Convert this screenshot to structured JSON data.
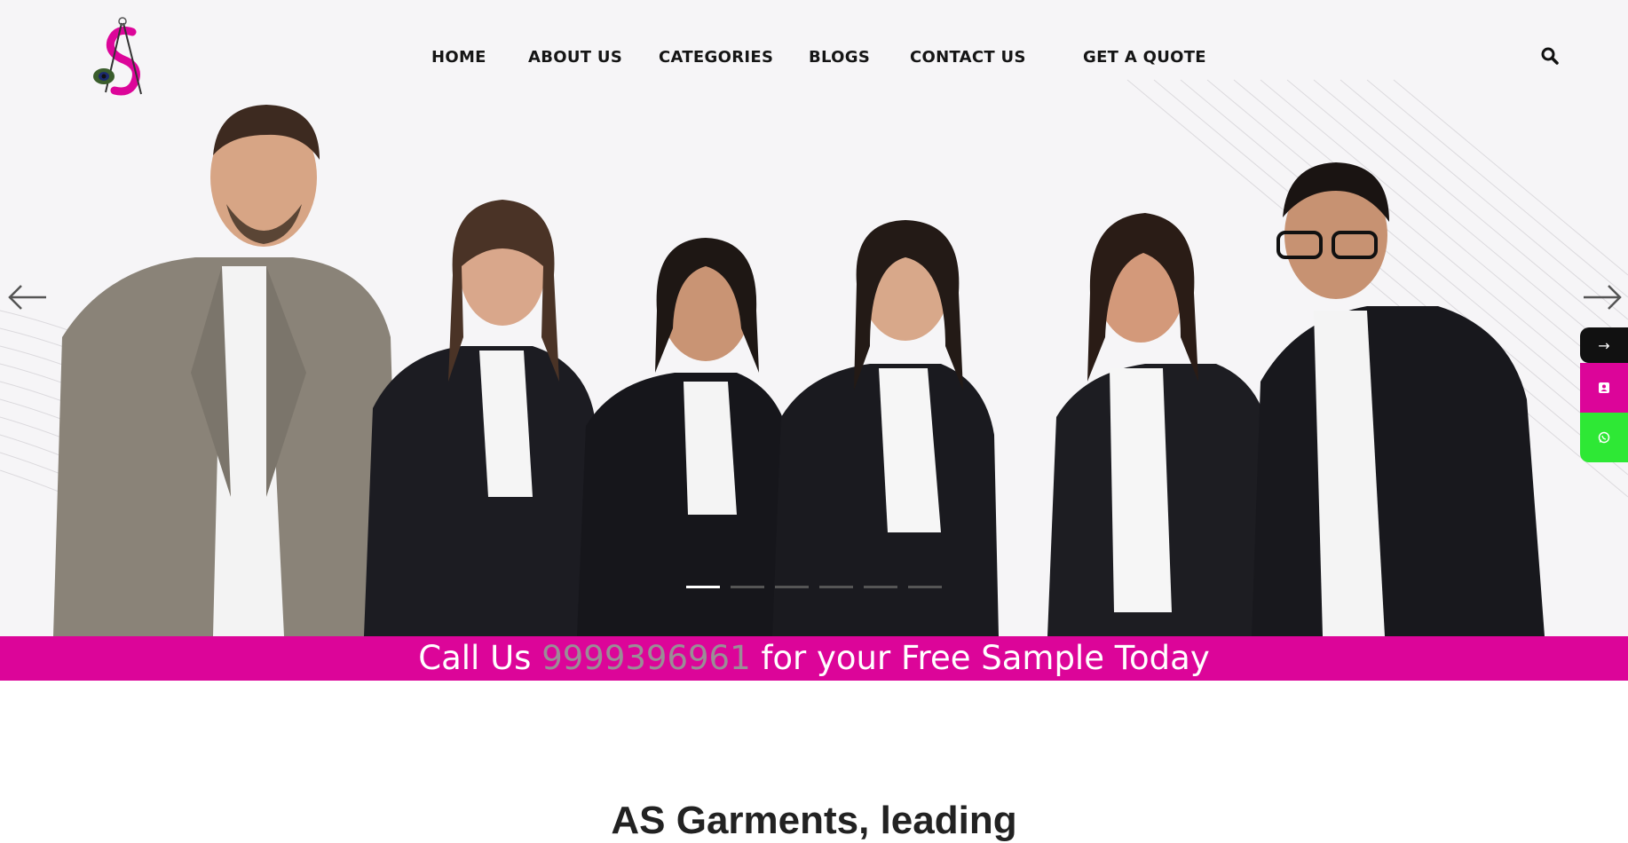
{
  "nav": {
    "items": [
      {
        "label": "HOME"
      },
      {
        "label": "ABOUT US"
      },
      {
        "label": "CATEGORIES"
      },
      {
        "label": "BLOGS"
      },
      {
        "label": "CONTACT US"
      },
      {
        "label": "GET A QUOTE"
      }
    ]
  },
  "header": {
    "logo_letter": "S",
    "search_icon": "search-icon"
  },
  "slider": {
    "prev_icon": "arrow-left-icon",
    "next_icon": "arrow-right-icon",
    "slide_count": 6,
    "active_slide": 1
  },
  "side_tabs": [
    {
      "icon": "arrow-right-icon",
      "glyph": "→",
      "color": "#111111"
    },
    {
      "icon": "contact-card-icon",
      "glyph": "▪",
      "color": "#dc0599"
    },
    {
      "icon": "whatsapp-icon",
      "glyph": "◯",
      "color": "#2ee835"
    }
  ],
  "banner": {
    "prefix": "Call Us ",
    "phone": "9999396961",
    "suffix": " for your Free Sample Today"
  },
  "section": {
    "heading": "AS Garments, leading"
  },
  "colors": {
    "brand": "#dc0599",
    "phone_text": "#9a8d96",
    "whatsapp": "#2ee835"
  }
}
